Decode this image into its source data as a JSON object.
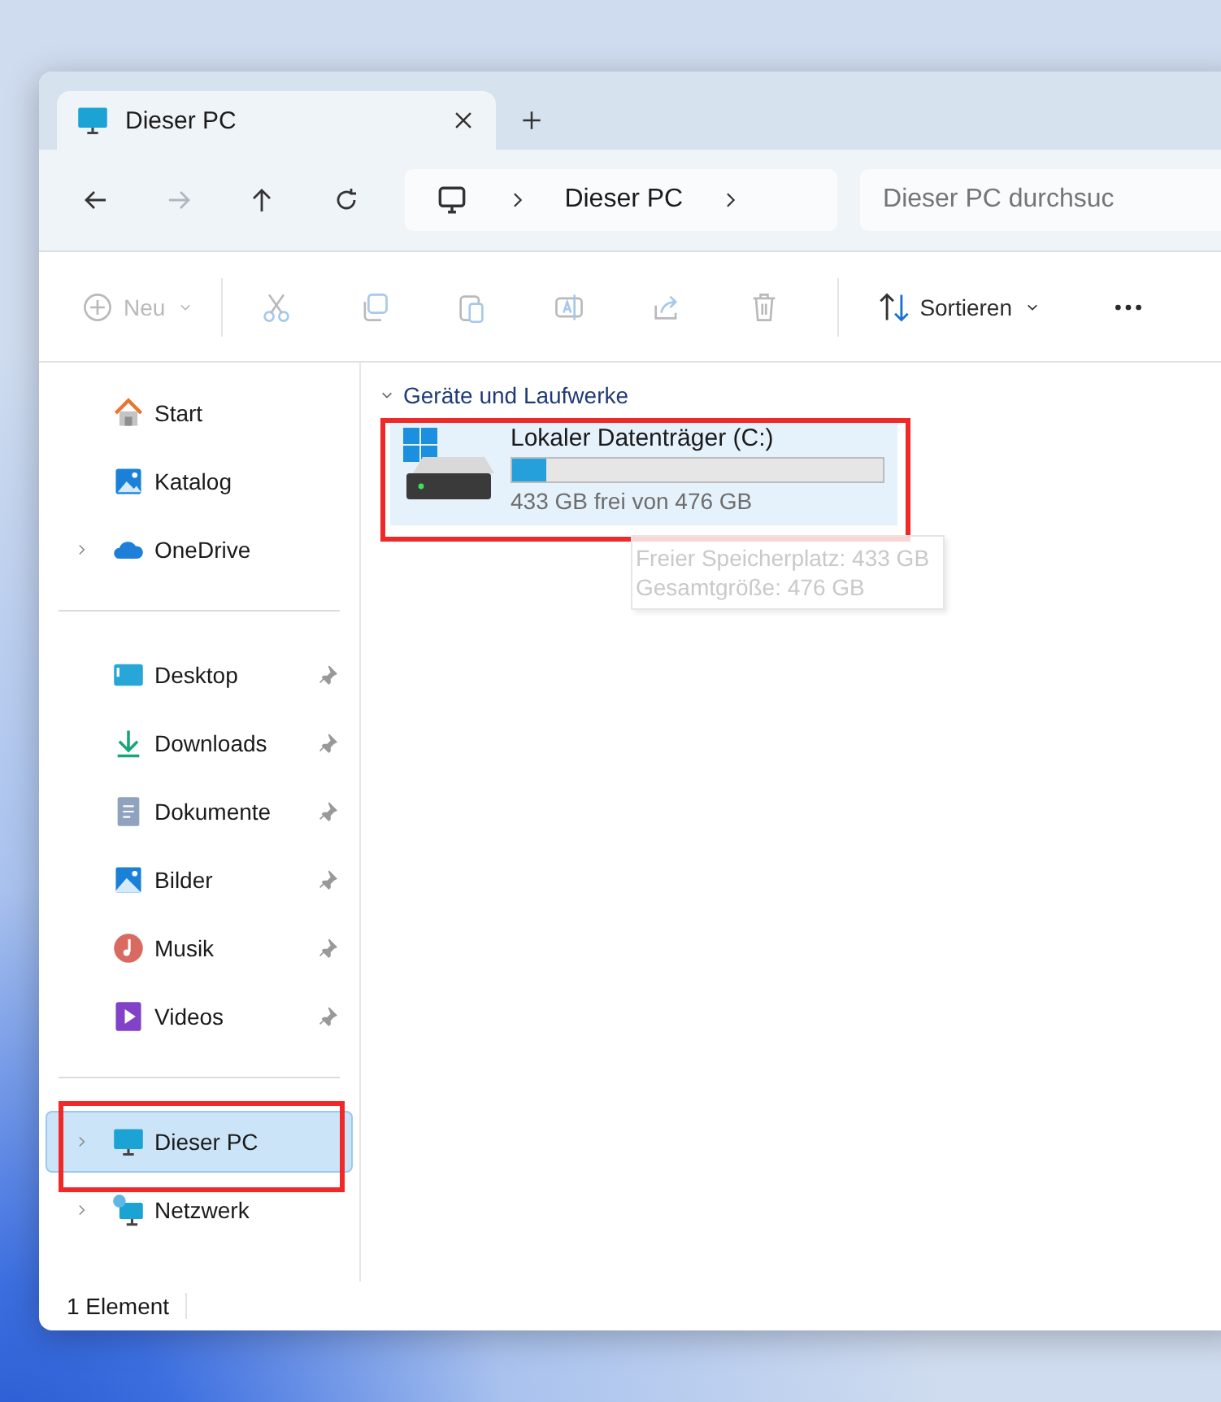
{
  "tabs": [
    {
      "label": "Dieser PC",
      "selected": true
    }
  ],
  "nav_buttons": [
    {
      "kind": "back",
      "disabled": false
    },
    {
      "kind": "forward",
      "disabled": true
    },
    {
      "kind": "up",
      "disabled": false
    },
    {
      "kind": "refresh",
      "disabled": false
    }
  ],
  "breadcrumb": [
    "Dieser PC"
  ],
  "search": {
    "placeholder": "Dieser PC durchsuc"
  },
  "toolbar": [
    {
      "kind": "new",
      "label": "Neu",
      "disabled": true
    },
    {
      "kind": "cut",
      "disabled": true
    },
    {
      "kind": "copy",
      "disabled": true
    },
    {
      "kind": "paste",
      "disabled": true
    },
    {
      "kind": "rename",
      "disabled": true
    },
    {
      "kind": "share",
      "disabled": true
    },
    {
      "kind": "delete",
      "disabled": true
    },
    {
      "kind": "sort",
      "label": "Sortieren",
      "disabled": false
    },
    {
      "kind": "more",
      "disabled": false
    }
  ],
  "sidebar": {
    "groups": [
      {
        "items": [
          {
            "label": "Start",
            "expandable": false,
            "pinned": false,
            "selected": false,
            "highlighted": false
          },
          {
            "label": "Katalog",
            "expandable": false,
            "pinned": false,
            "selected": false,
            "highlighted": false
          },
          {
            "label": "OneDrive",
            "expandable": true,
            "pinned": false,
            "selected": false,
            "highlighted": false
          }
        ]
      },
      {
        "items": [
          {
            "label": "Desktop",
            "expandable": false,
            "pinned": true,
            "selected": false,
            "highlighted": false
          },
          {
            "label": "Downloads",
            "expandable": false,
            "pinned": true,
            "selected": false,
            "highlighted": false
          },
          {
            "label": "Dokumente",
            "expandable": false,
            "pinned": true,
            "selected": false,
            "highlighted": false
          },
          {
            "label": "Bilder",
            "expandable": false,
            "pinned": true,
            "selected": false,
            "highlighted": false
          },
          {
            "label": "Musik",
            "expandable": false,
            "pinned": true,
            "selected": false,
            "highlighted": false
          },
          {
            "label": "Videos",
            "expandable": false,
            "pinned": true,
            "selected": false,
            "highlighted": false
          }
        ]
      },
      {
        "items": [
          {
            "label": "Dieser PC",
            "expandable": true,
            "pinned": false,
            "selected": true,
            "highlighted": true
          },
          {
            "label": "Netzwerk",
            "expandable": true,
            "pinned": false,
            "selected": false,
            "highlighted": false
          }
        ]
      }
    ]
  },
  "content": {
    "section": {
      "title": "Geräte und Laufwerke",
      "expanded": true
    },
    "drives": [
      {
        "name": "Lokaler Datenträger (C:)",
        "level": 0.09,
        "reading": "433 GB frei von 476 GB",
        "selected": true,
        "highlighted": true
      }
    ],
    "tooltip": [
      "Freier Speicherplatz: 433 GB",
      "Gesamtgröße: 476 GB"
    ]
  },
  "status_bar": {
    "count": "1 Element"
  }
}
